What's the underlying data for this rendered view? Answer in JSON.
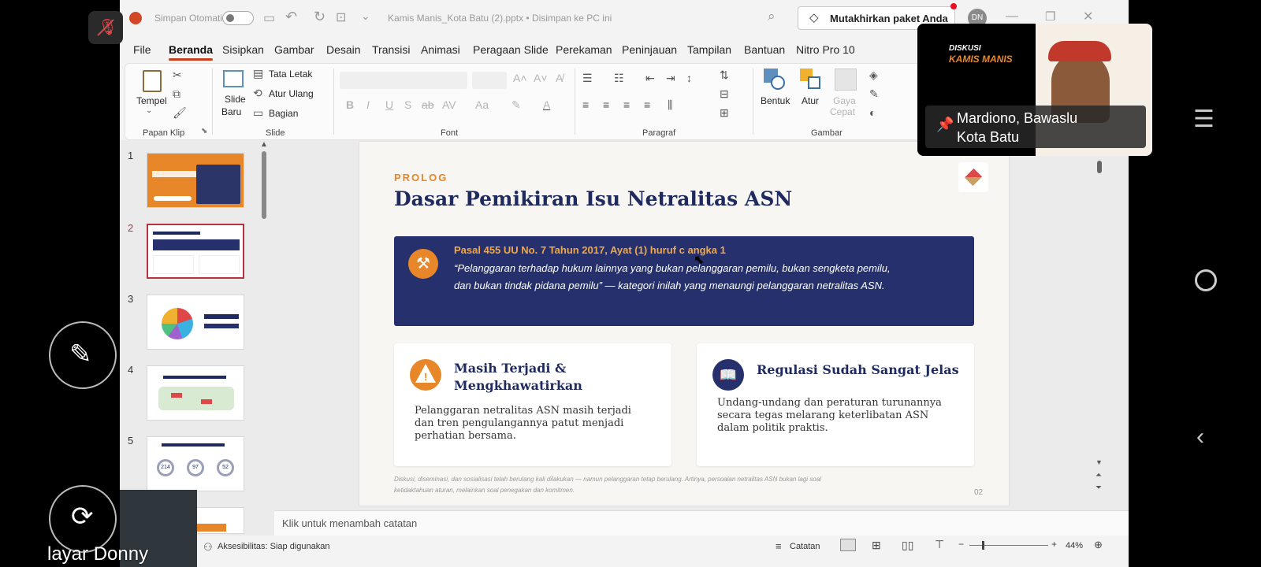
{
  "host": {
    "autosave_label": "Simpan Otomatis",
    "document_title": "Kamis Manis_Kota Batu (2).pptx • Disimpan ke PC ini",
    "upgrade_label": "Mutakhirkan paket Anda",
    "user_initials": "DN"
  },
  "ribbon_tabs": [
    "File",
    "Beranda",
    "Sisipkan",
    "Gambar",
    "Desain",
    "Transisi",
    "Animasi",
    "Peragaan Slide",
    "Perekaman",
    "Peninjauan",
    "Tampilan",
    "Bantuan",
    "Nitro Pro 10"
  ],
  "ribbon": {
    "paste": "Tempel",
    "new_slide_1": "Slide",
    "new_slide_2": "Baru",
    "layout": "Tata Letak",
    "reset": "Atur Ulang",
    "section": "Bagian",
    "shapes": "Bentuk",
    "arrange": "Atur",
    "quick_styles_1": "Gaya",
    "quick_styles_2": "Cepat",
    "groups": {
      "clipboard": "Papan Klip",
      "slides": "Slide",
      "font": "Font",
      "paragraph": "Paragraf",
      "drawing": "Gambar"
    }
  },
  "thumbnails": [
    {
      "num": "1",
      "title": "NETRALITAS ASN"
    },
    {
      "num": "2",
      "title": "Dasar Pemikiran Isu Netralitas ASN"
    },
    {
      "num": "3",
      "title": "Data Pelanggaran Netralitas ASN 2019"
    },
    {
      "num": "4",
      "title": "Peta Pelanggaran Netralitas ASN 2024"
    },
    {
      "num": "5",
      "title": "Jumlah Pelanggaran Netralitas Berdasarkan Jenis Pelanggaran",
      "stats": [
        "214",
        "97",
        "52"
      ]
    }
  ],
  "slide": {
    "kicker": "PROLOG",
    "title": "Dasar Pemikiran Isu Netralitas ASN",
    "banner_heading": "Pasal 455 UU No. 7 Tahun 2017, Ayat (1) huruf c angka 1",
    "banner_quote_1": "“Pelanggaran terhadap hukum lainnya yang bukan pelanggaran pemilu, bukan sengketa pemilu,",
    "banner_quote_2": "dan bukan tindak pidana pemilu” — kategori inilah yang menaungi pelanggaran netralitas ASN.",
    "card1_title_1": "Masih Terjadi &",
    "card1_title_2": "Mengkhawatirkan",
    "card1_body_1": "Pelanggaran netralitas ASN masih terjadi",
    "card1_body_2": "dan tren pengulangannya patut menjadi",
    "card1_body_3": "perhatian bersama.",
    "card2_title": "Regulasi Sudah Sangat Jelas",
    "card2_body_1": "Undang-undang dan peraturan turunannya",
    "card2_body_2": "secara tegas melarang keterlibatan ASN",
    "card2_body_3": "dalam politik praktis.",
    "footer_1": "Diskusi, diseminasi, dan sosialisasi telah berulang kali dilakukan — namun pelanggaran tetap berulang. Artinya, persoalan netralitas ASN bukan lagi soal",
    "footer_2": "ketidaktahuan aturan, melainkan soal penegakan dan komitmen.",
    "page_number": "02"
  },
  "notes_placeholder": "Klik untuk menambah catatan",
  "status": {
    "accessibility": "Aksesibilitas: Siap digunakan",
    "notes": "Catatan",
    "zoom": "44%"
  },
  "meeting": {
    "screen_owner": "layar Donny",
    "speaker_line_1": "Mardiono, Bawaslu",
    "speaker_line_2": "Kota Batu",
    "video_title_1": "DISKUSI",
    "video_title_2": "KAMIS MANIS"
  },
  "colors": {
    "accent_red": "#c43e1c",
    "navy": "#25306c",
    "orange": "#e8862a",
    "slide_title": "#1f2a5e"
  }
}
